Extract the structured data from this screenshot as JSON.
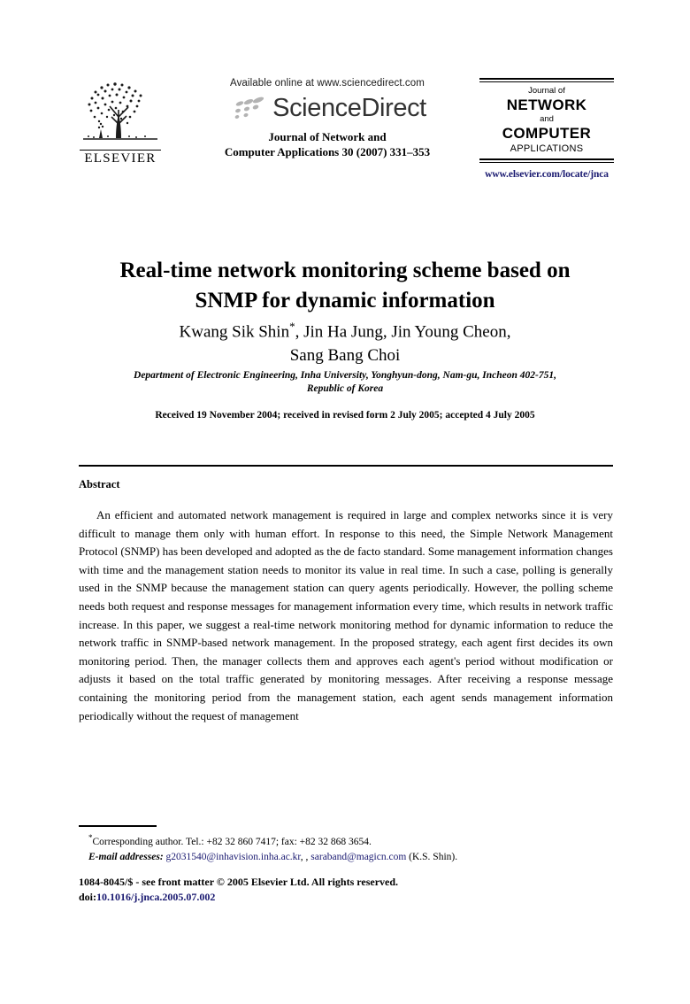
{
  "header": {
    "available_online": "Available online at www.sciencedirect.com",
    "sciencedirect_wordmark": "ScienceDirect",
    "journal_line_1": "Journal of Network and",
    "journal_line_2": "Computer Applications 30 (2007) 331–353",
    "elsevier_wordmark": "ELSEVIER",
    "journal_box": {
      "line_journal_of": "Journal of",
      "line_network": "NETWORK",
      "line_and": "and",
      "line_computer": "COMPUTER",
      "line_applications": "APPLICATIONS"
    },
    "elsevier_url": "www.elsevier.com/locate/jnca"
  },
  "article": {
    "title_line_1": "Real-time network monitoring scheme based on",
    "title_line_2": "SNMP for dynamic information",
    "authors_line_1": "Kwang Sik Shin",
    "authors_marker": "*",
    "authors_line_1_rest": ", Jin Ha Jung, Jin Young Cheon,",
    "authors_line_2": "Sang Bang Choi",
    "affiliation_line_1": "Department of Electronic Engineering, Inha University, Yonghyun-dong, Nam-gu, Incheon 402-751,",
    "affiliation_line_2": "Republic of Korea",
    "dates": "Received 19 November 2004; received in revised form 2 July 2005; accepted 4 July 2005"
  },
  "abstract": {
    "heading": "Abstract",
    "text": "An efficient and automated network management is required in large and complex networks since it is very difficult to manage them only with human effort. In response to this need, the Simple Network Management Protocol (SNMP) has been developed and adopted as the de facto standard. Some management information changes with time and the management station needs to monitor its value in real time. In such a case, polling is generally used in the SNMP because the management station can query agents periodically. However, the polling scheme needs both request and response messages for management information every time, which results in network traffic increase. In this paper, we suggest a real-time network monitoring method for dynamic information to reduce the network traffic in SNMP-based network management. In the proposed strategy, each agent first decides its own monitoring period. Then, the manager collects them and approves each agent's period without modification or adjusts it based on the total traffic generated by monitoring messages. After receiving a response message containing the monitoring period from the management station, each agent sends management information periodically without the request of management"
  },
  "footnotes": {
    "marker": "*",
    "corresponding": "Corresponding author. Tel.: +82 32 860 7417; fax: +82 32 868 3654.",
    "email_label": "E-mail addresses:",
    "email_1": "g2031540@inhavision.inha.ac.kr",
    "email_separator": ", ,",
    "email_2": "saraband@magicn.com",
    "email_suffix": "(K.S. Shin)."
  },
  "frontmatter": {
    "line": "1084-8045/$ - see front matter © 2005 Elsevier Ltd. All rights reserved.",
    "doi_label": "doi:",
    "doi_value": "10.1016/j.jnca.2005.07.002"
  },
  "colors": {
    "link": "#191970",
    "text": "#000000",
    "sciencedirect_gray": "#333333",
    "background": "#ffffff"
  }
}
